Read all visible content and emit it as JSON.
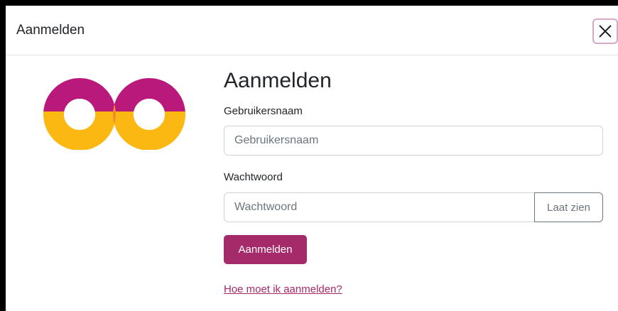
{
  "modal": {
    "title": "Aanmelden",
    "close_icon": "close-icon"
  },
  "logo": {
    "icon": "logo-icon",
    "colors": {
      "magenta": "#b8197b",
      "yellow": "#fbb812",
      "orange": "#f28c30"
    }
  },
  "form": {
    "heading": "Aanmelden",
    "username": {
      "label": "Gebruikersnaam",
      "placeholder": "Gebruikersnaam",
      "value": ""
    },
    "password": {
      "label": "Wachtwoord",
      "placeholder": "Wachtwoord",
      "value": "",
      "show_label": "Laat zien"
    },
    "submit_label": "Aanmelden",
    "help_link": "Hoe moet ik aanmelden?"
  },
  "colors": {
    "accent": "#a52a6a",
    "close_border": "#d7a8c8"
  }
}
